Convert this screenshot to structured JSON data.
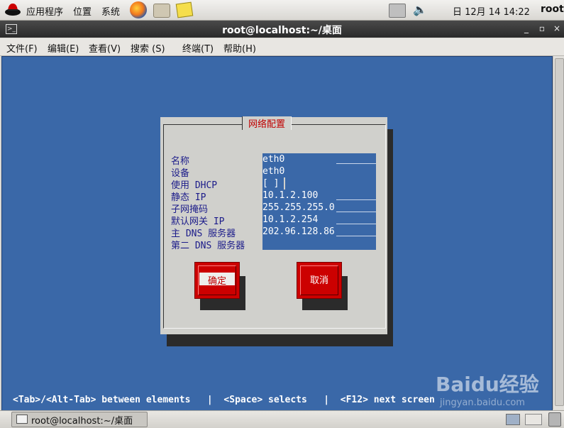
{
  "top_panel": {
    "menus": [
      "应用程序",
      "位置",
      "系统"
    ],
    "clock": "日 12月 14 14:22",
    "user": "root"
  },
  "window": {
    "title": "root@localhost:~/桌面"
  },
  "menubar": [
    "文件(F)",
    "编辑(E)",
    "查看(V)",
    "搜索 (S)",
    "终端(T)",
    "帮助(H)"
  ],
  "dialog": {
    "title": "网络配置",
    "fields": [
      {
        "label": "名称",
        "value": "eth0"
      },
      {
        "label": "设备",
        "value": "eth0"
      },
      {
        "label": "使用 DHCP",
        "value": "[ ]"
      },
      {
        "label": "静态 IP",
        "value": "10.1.2.100"
      },
      {
        "label": "子网掩码",
        "value": "255.255.255.0"
      },
      {
        "label": "默认网关 IP",
        "value": "10.1.2.254"
      },
      {
        "label": "主 DNS 服务器",
        "value": "202.96.128.86"
      },
      {
        "label": "第二 DNS 服务器",
        "value": ""
      }
    ],
    "ok_label": "确定",
    "cancel_label": "取消"
  },
  "terminal": {
    "hint": "<Tab>/<Alt-Tab> between elements   |  <Space> selects   |  <F12> next screen"
  },
  "watermark": {
    "logo": "Baidu经验",
    "url": "jingyan.baidu.com"
  },
  "taskbar": {
    "task_label": "root@localhost:~/桌面"
  },
  "colors": {
    "terminal_bg": "#3a68a8",
    "dialog_bg": "#d0d0cc",
    "title_red": "#c00000",
    "button_red": "#cc0000"
  }
}
